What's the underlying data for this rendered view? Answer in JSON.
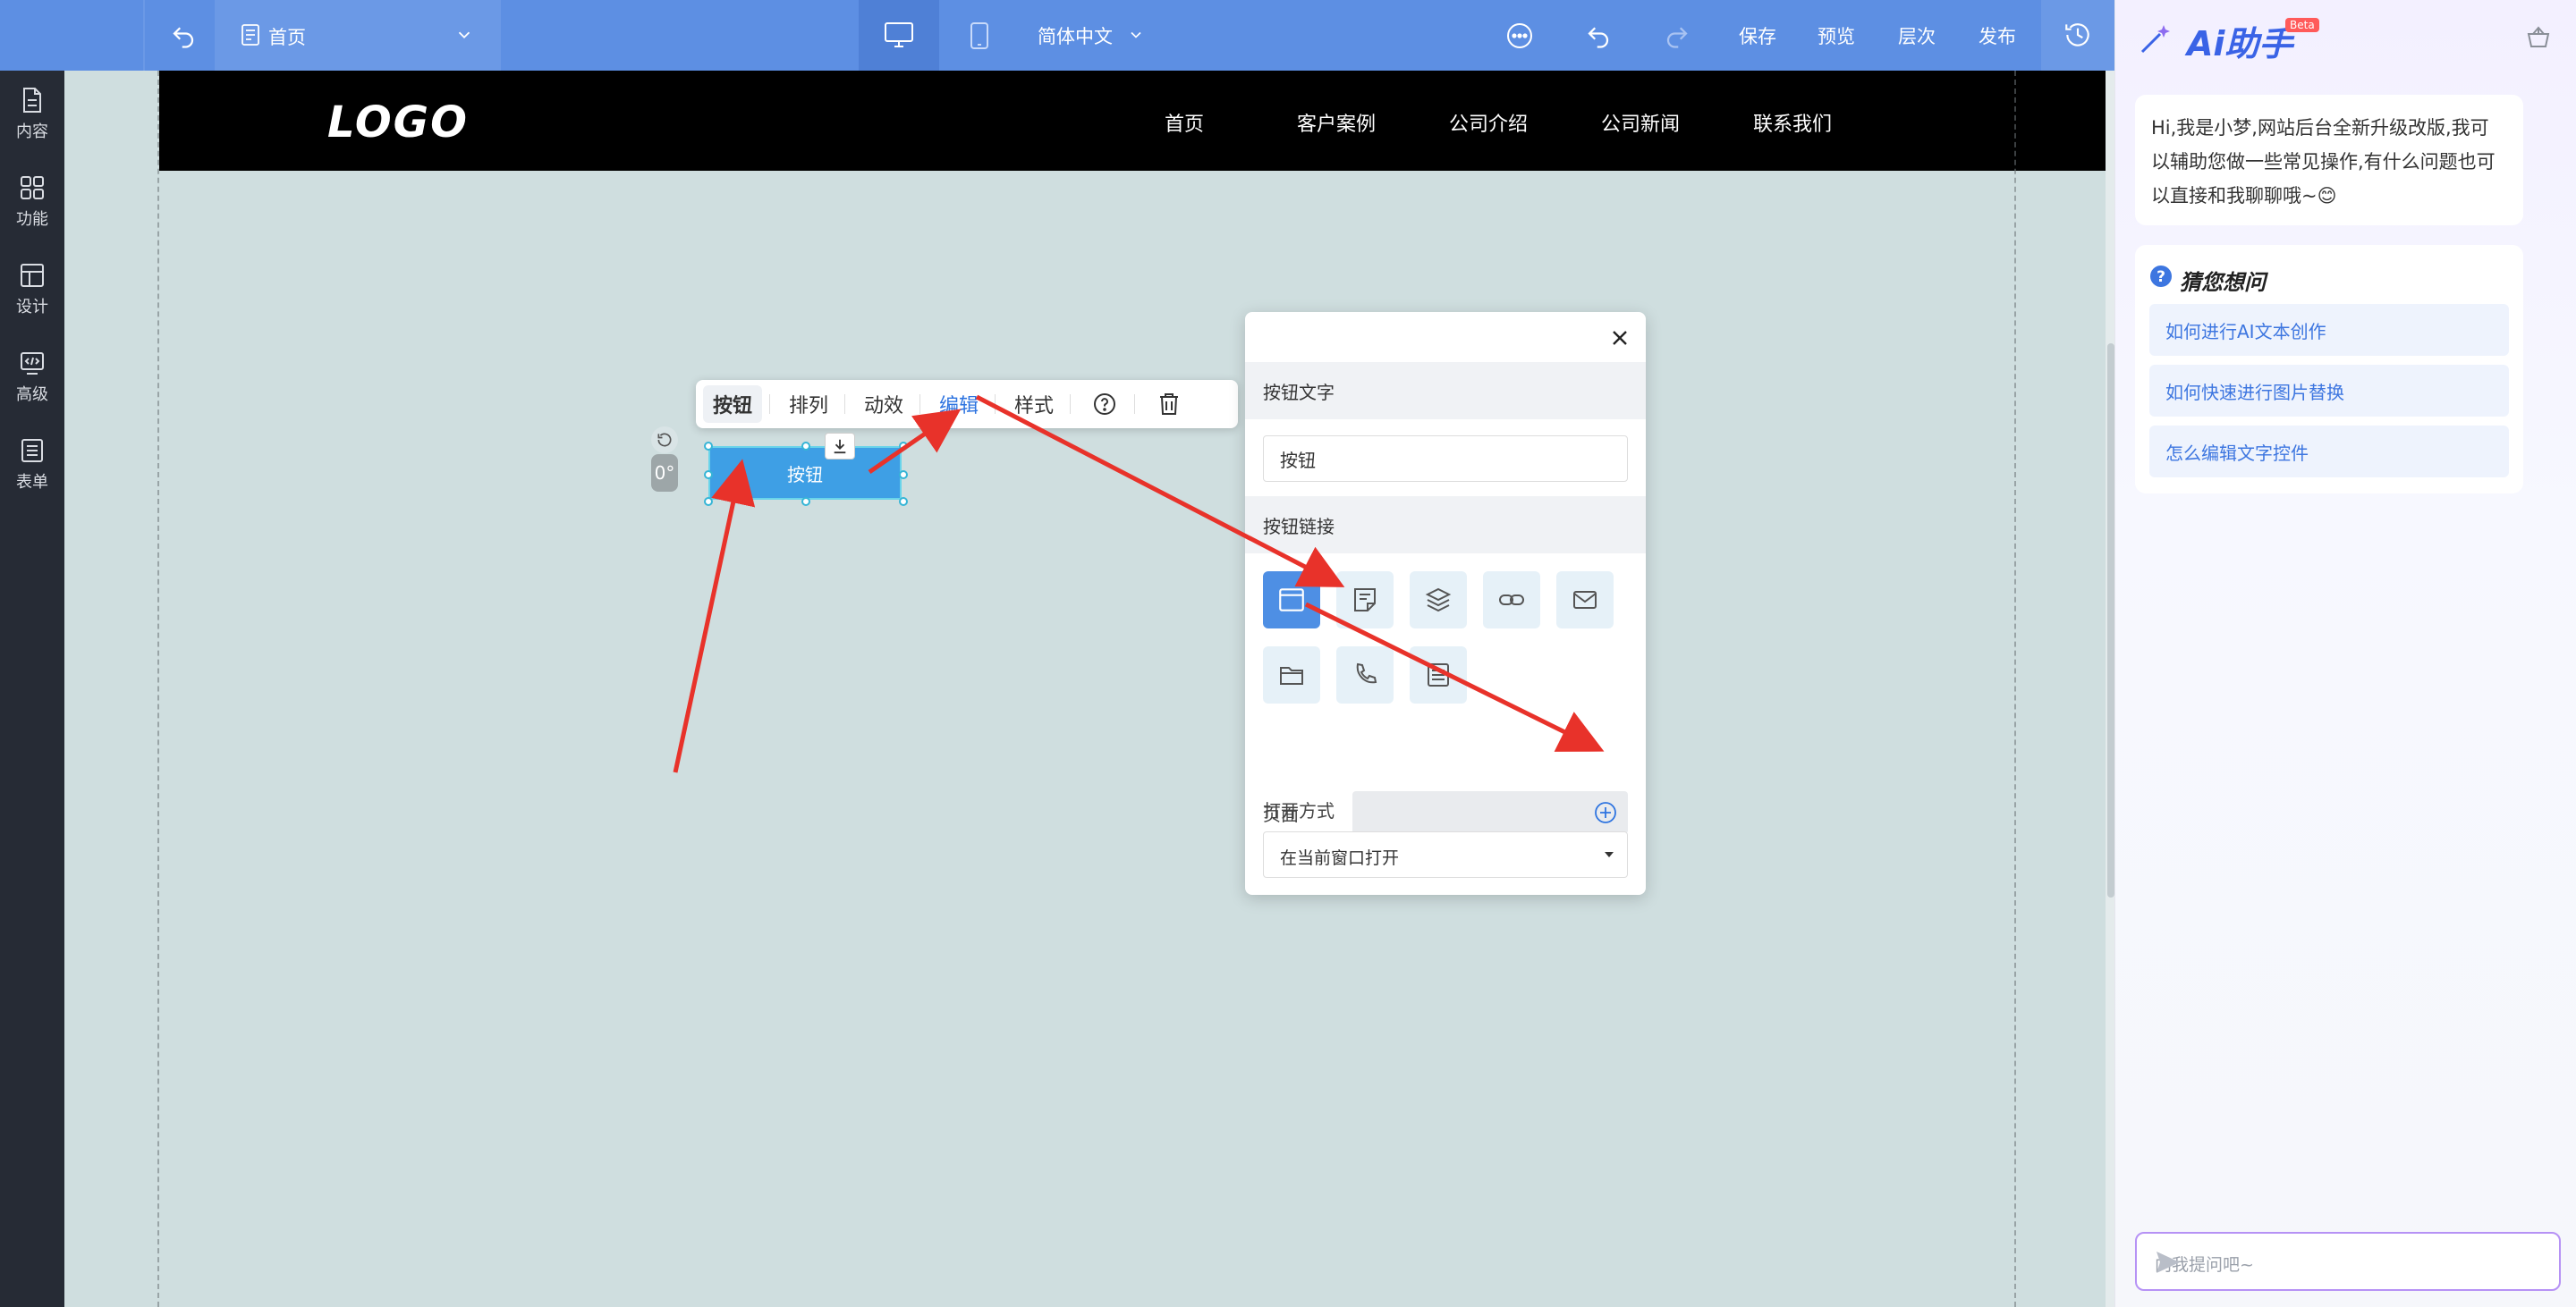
{
  "topbar": {
    "page_name": "首页",
    "language": "简体中文",
    "save": "保存",
    "preview": "预览",
    "layers": "层次",
    "publish": "发布"
  },
  "sidebar": {
    "items": [
      {
        "label": "内容",
        "icon": "document-icon"
      },
      {
        "label": "功能",
        "icon": "grid-icon"
      },
      {
        "label": "设计",
        "icon": "layout-icon"
      },
      {
        "label": "高级",
        "icon": "code-icon"
      },
      {
        "label": "表单",
        "icon": "form-icon"
      }
    ]
  },
  "site": {
    "logo": "LOGO",
    "nav": [
      "首页",
      "客户案例",
      "公司介绍",
      "公司新闻",
      "联系我们"
    ]
  },
  "element_toolbar": {
    "items": [
      "按钮",
      "排列",
      "动效",
      "编辑",
      "样式"
    ],
    "active": "编辑"
  },
  "selected_button": {
    "label": "按钮",
    "rotation": "0°"
  },
  "edit_panel": {
    "text_section": "按钮文字",
    "text_value": "按钮",
    "link_section": "按钮链接",
    "page_label": "页面",
    "page_value": "",
    "open_label": "打开方式",
    "open_value": "在当前窗口打开"
  },
  "ai": {
    "title": "Ai助手",
    "beta": "Beta",
    "greeting": "Hi,我是小梦,网站后台全新升级改版,我可以辅助您做一些常见操作,有什么问题也可以直接和我聊聊哦~😊",
    "guess_title": "猜您想问",
    "questions": [
      "如何进行AI文本创作",
      "如何快速进行图片替换",
      "怎么编辑文字控件"
    ],
    "input_placeholder": "向我提问吧~"
  },
  "colors": {
    "topbar": "#5d8fe3",
    "sidebar": "#262b35",
    "canvas": "#cfdedf",
    "accent": "#2e74e0",
    "annotation": "#e8322a"
  }
}
